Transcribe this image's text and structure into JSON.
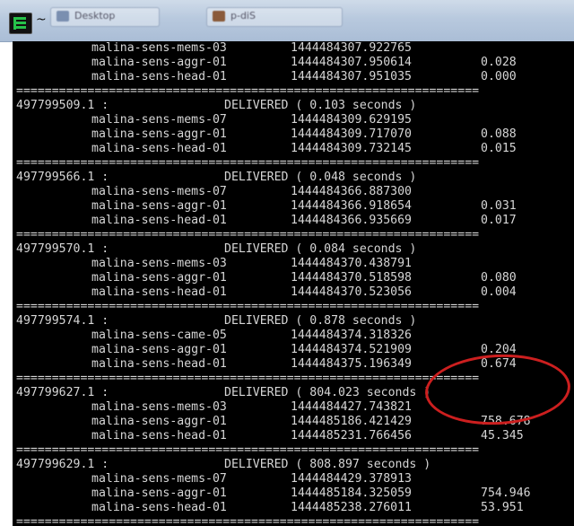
{
  "window": {
    "title": "~"
  },
  "taskbar": {
    "buttons": [
      {
        "label": "Desktop"
      },
      {
        "label": "p-diS"
      }
    ]
  },
  "terminal": {
    "separator": "=================================================================",
    "top_rows": [
      {
        "name": "malina-sens-mems-03",
        "time": "1444484307.922765",
        "delta": ""
      },
      {
        "name": "malina-sens-aggr-01",
        "time": "1444484307.950614",
        "delta": "0.028"
      },
      {
        "name": "malina-sens-head-01",
        "time": "1444484307.951035",
        "delta": "0.000"
      }
    ],
    "blocks": [
      {
        "id": "497799509.1 :",
        "status": "DELIVERED ( 0.103 seconds )",
        "rows": [
          {
            "name": "malina-sens-mems-07",
            "time": "1444484309.629195",
            "delta": ""
          },
          {
            "name": "malina-sens-aggr-01",
            "time": "1444484309.717070",
            "delta": "0.088"
          },
          {
            "name": "malina-sens-head-01",
            "time": "1444484309.732145",
            "delta": "0.015"
          }
        ]
      },
      {
        "id": "497799566.1 :",
        "status": "DELIVERED ( 0.048 seconds )",
        "rows": [
          {
            "name": "malina-sens-mems-07",
            "time": "1444484366.887300",
            "delta": ""
          },
          {
            "name": "malina-sens-aggr-01",
            "time": "1444484366.918654",
            "delta": "0.031"
          },
          {
            "name": "malina-sens-head-01",
            "time": "1444484366.935669",
            "delta": "0.017"
          }
        ]
      },
      {
        "id": "497799570.1 :",
        "status": "DELIVERED ( 0.084 seconds )",
        "rows": [
          {
            "name": "malina-sens-mems-03",
            "time": "1444484370.438791",
            "delta": ""
          },
          {
            "name": "malina-sens-aggr-01",
            "time": "1444484370.518598",
            "delta": "0.080"
          },
          {
            "name": "malina-sens-head-01",
            "time": "1444484370.523056",
            "delta": "0.004"
          }
        ]
      },
      {
        "id": "497799574.1 :",
        "status": "DELIVERED ( 0.878 seconds )",
        "rows": [
          {
            "name": "malina-sens-came-05",
            "time": "1444484374.318326",
            "delta": ""
          },
          {
            "name": "malina-sens-aggr-01",
            "time": "1444484374.521909",
            "delta": "0.204"
          },
          {
            "name": "malina-sens-head-01",
            "time": "1444484375.196349",
            "delta": "0.674"
          }
        ]
      },
      {
        "id": "497799627.1 :",
        "status": "DELIVERED ( 804.023 seconds )",
        "rows": [
          {
            "name": "malina-sens-mems-03",
            "time": "1444484427.743821",
            "delta": ""
          },
          {
            "name": "malina-sens-aggr-01",
            "time": "1444485186.421429",
            "delta": "758.678"
          },
          {
            "name": "malina-sens-head-01",
            "time": "1444485231.766456",
            "delta": "45.345"
          }
        ]
      },
      {
        "id": "497799629.1 :",
        "status": "DELIVERED ( 808.897 seconds )",
        "rows": [
          {
            "name": "malina-sens-mems-07",
            "time": "1444484429.378913",
            "delta": ""
          },
          {
            "name": "malina-sens-aggr-01",
            "time": "1444485184.325059",
            "delta": "754.946"
          },
          {
            "name": "malina-sens-head-01",
            "time": "1444485238.276011",
            "delta": "53.951"
          }
        ]
      }
    ]
  },
  "colors": {
    "terminal_bg": "#000000",
    "terminal_fg": "#d6d6d6",
    "highlight_circle": "#cc1f1f",
    "titlebar": "#b8c9de"
  }
}
